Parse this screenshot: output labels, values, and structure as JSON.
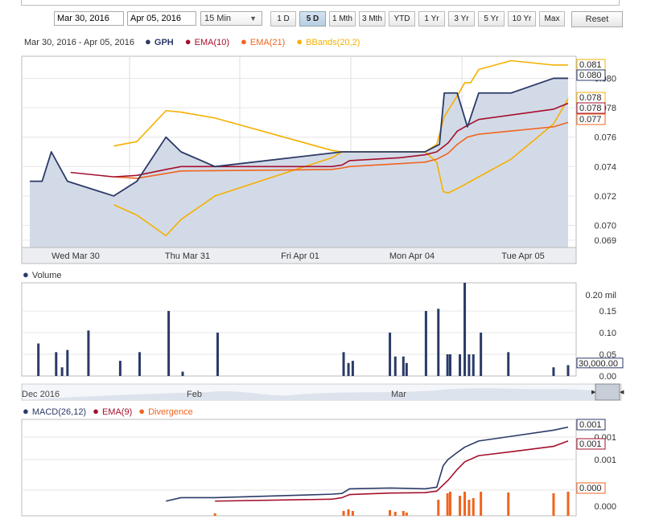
{
  "toolbar": {
    "start_date": "Mar 30, 2016",
    "end_date": "Apr 05, 2016",
    "interval": "15 Min",
    "ranges": [
      "1 D",
      "5 D",
      "1 Mth",
      "3 Mth",
      "YTD",
      "1 Yr",
      "3 Yr",
      "5 Yr",
      "10 Yr",
      "Max"
    ],
    "active_range": "5 D",
    "reset_label": "Reset"
  },
  "legend": {
    "date_range": "Mar 30, 2016 - Apr 05, 2016",
    "items": [
      {
        "label": "GPH",
        "color": "#2b3a67",
        "bold": true
      },
      {
        "label": "EMA(10)",
        "color": "#a50f2d",
        "bold": false
      },
      {
        "label": "EMA(21)",
        "color": "#f0641e",
        "bold": false
      },
      {
        "label": "BBands(20,2)",
        "color": "#f5b000",
        "bold": false
      }
    ]
  },
  "chart_data": [
    {
      "type": "area",
      "x_ticks": [
        "Wed Mar 30",
        "Thu Mar 31",
        "Fri Apr 01",
        "Mon Apr 04",
        "Tue Apr 05"
      ],
      "y_ticks": [
        0.069,
        0.07,
        0.072,
        0.074,
        0.076,
        0.078,
        0.08
      ],
      "ylim": [
        0.0685,
        0.0815
      ],
      "xlim": [
        0,
        100
      ],
      "grid": true,
      "last_value_labels": [
        {
          "text": "0.081",
          "value": 0.0812,
          "color": "#f5b000"
        },
        {
          "text": "0.080",
          "value": 0.08,
          "color": "#2b3a67"
        },
        {
          "text": "0.078",
          "value": 0.0786,
          "color": "#f5b000"
        },
        {
          "text": "0.078",
          "value": 0.078,
          "color": "#a50f2d"
        },
        {
          "text": "0.077",
          "value": 0.0772,
          "color": "#f0641e"
        }
      ],
      "series": [
        {
          "name": "GPH",
          "color": "#2b3a67",
          "fill": "#d3dae7",
          "x": [
            0,
            2.3,
            4,
            7,
            15.6,
            19.9,
            25.3,
            28.1,
            34.4,
            58,
            73.4,
            76.1,
            77,
            79.4,
            81.3,
            83.4,
            89.4,
            97.3,
            100
          ],
          "y": [
            0.073,
            0.073,
            0.075,
            0.073,
            0.072,
            0.073,
            0.076,
            0.075,
            0.074,
            0.075,
            0.075,
            0.0755,
            0.079,
            0.079,
            0.0767,
            0.079,
            0.079,
            0.08,
            0.08
          ]
        },
        {
          "name": "EMA(10)",
          "color": "#a50f2d",
          "x": [
            7.6,
            15.6,
            19.9,
            25.3,
            28.1,
            56.1,
            58,
            59.4,
            68.8,
            73.4,
            75.6,
            77.7,
            79.4,
            81.3,
            83.4,
            97.3,
            100
          ],
          "y": [
            0.0736,
            0.0733,
            0.0734,
            0.0738,
            0.074,
            0.074,
            0.0741,
            0.0744,
            0.0746,
            0.0748,
            0.075,
            0.0756,
            0.0764,
            0.0768,
            0.0772,
            0.0779,
            0.0783
          ]
        },
        {
          "name": "EMA(21)",
          "color": "#f0641e",
          "x": [
            15.6,
            19.9,
            28.1,
            56.1,
            58,
            59.4,
            68.8,
            73.4,
            75.6,
            77.7,
            79.4,
            81.3,
            83.4,
            97.3,
            100
          ],
          "y": [
            0.0733,
            0.0732,
            0.0737,
            0.0738,
            0.0739,
            0.074,
            0.0742,
            0.0743,
            0.0745,
            0.0749,
            0.0755,
            0.076,
            0.0762,
            0.0767,
            0.077
          ]
        },
        {
          "name": "BBands upper",
          "color": "#f5b000",
          "x": [
            15.6,
            19.9,
            25.3,
            28.1,
            34.4,
            56.1,
            58,
            73.4,
            75.6,
            77,
            79.4,
            80.8,
            81.9,
            83.4,
            89.4,
            97.3,
            100
          ],
          "y": [
            0.0754,
            0.0757,
            0.0778,
            0.0777,
            0.0773,
            0.0751,
            0.075,
            0.075,
            0.0755,
            0.0774,
            0.0788,
            0.0797,
            0.0797,
            0.0806,
            0.0812,
            0.0809,
            0.0809
          ]
        },
        {
          "name": "BBands lower",
          "color": "#f5b000",
          "x": [
            15.6,
            19.9,
            25.3,
            28.1,
            34.4,
            56.1,
            58,
            73.4,
            75.6,
            76.8,
            77.7,
            79.4,
            83.4,
            89.4,
            97.3,
            100
          ],
          "y": [
            0.0714,
            0.0707,
            0.0693,
            0.0704,
            0.072,
            0.0746,
            0.075,
            0.075,
            0.0743,
            0.0723,
            0.0722,
            0.0725,
            0.0733,
            0.0745,
            0.0769,
            0.0786
          ]
        }
      ]
    },
    {
      "type": "bar",
      "title": "Volume",
      "y_ticks": [
        0.0,
        0.05,
        0.1,
        0.15
      ],
      "y_tick_labels": [
        "0.00",
        "0.05",
        "0.10",
        "0.15"
      ],
      "top_label": "0.20 mil",
      "last_value_label": "30,000.00",
      "last_value": 0.03,
      "ylim": [
        0,
        0.215
      ],
      "xlim": [
        0,
        100
      ],
      "series": [
        {
          "name": "Volume",
          "color": "#2b3a67",
          "x": [
            1.6,
            4.9,
            6,
            7,
            10.9,
            16.8,
            20.4,
            25.8,
            28.4,
            34.9,
            58.3,
            59.2,
            60,
            66.9,
            67.9,
            69.4,
            70,
            73.6,
            75.9,
            77.6,
            78.1,
            79.9,
            80.8,
            81.6,
            82.4,
            83.8,
            88.9,
            97.3,
            100
          ],
          "y": [
            0.075,
            0.055,
            0.02,
            0.06,
            0.105,
            0.035,
            0.055,
            0.15,
            0.01,
            0.1,
            0.055,
            0.03,
            0.035,
            0.1,
            0.045,
            0.045,
            0.03,
            0.15,
            0.155,
            0.05,
            0.05,
            0.05,
            0.215,
            0.05,
            0.05,
            0.1,
            0.055,
            0.02,
            0.025
          ]
        }
      ]
    },
    {
      "type": "area",
      "title": "navigator",
      "x_ticks": [
        "Dec 2016",
        "Feb",
        "Mar"
      ],
      "series": []
    },
    {
      "type": "line",
      "y_tick_labels": [
        "0.001",
        "0.001",
        "0.000"
      ],
      "ylim": [
        -0.0011,
        0.0014
      ],
      "xlim": [
        0,
        100
      ],
      "last_value_labels": [
        {
          "text": "0.001",
          "value": 0.00122,
          "color": "#2b3a67"
        },
        {
          "text": "0.001",
          "value": 0.00082,
          "color": "#a50f2d"
        },
        {
          "text": "0.000",
          "value": -0.00032,
          "color": "#f0641e"
        }
      ],
      "series": [
        {
          "name": "MACD(26,12)",
          "color": "#2b3a67",
          "x": [
            25.3,
            28.1,
            34.4,
            56.1,
            58,
            59.4,
            66.9,
            73.4,
            75.6,
            76.8,
            77.7,
            79.4,
            80.8,
            83.4,
            89.4,
            97.3,
            100
          ],
          "y": [
            -0.00072,
            -0.00063,
            -0.00063,
            -0.00054,
            -0.00052,
            -0.0004,
            -0.00038,
            -0.0004,
            -0.00036,
            0.0002,
            0.00036,
            0.00054,
            0.00068,
            0.00084,
            0.00096,
            0.00112,
            0.0012
          ]
        },
        {
          "name": "EMA(9)",
          "color": "#a50f2d",
          "x": [
            34.4,
            56.1,
            58,
            59.4,
            66.9,
            73.4,
            75.6,
            77.7,
            79.4,
            80.8,
            83.4,
            89.4,
            97.3,
            100
          ],
          "y": [
            -0.00072,
            -0.00067,
            -0.00063,
            -0.00055,
            -0.00051,
            -0.0005,
            -0.00046,
            -0.00018,
            0.0001,
            0.0003,
            0.00046,
            0.00056,
            0.0007,
            0.00084
          ]
        },
        {
          "name": "Divergence",
          "color": "#f0641e",
          "type": "bar",
          "x": [
            34.4,
            58.3,
            59.2,
            60,
            66.9,
            67.9,
            69.4,
            70,
            75.9,
            77.6,
            78.1,
            79.9,
            80.8,
            81.6,
            82.4,
            83.8,
            88.9,
            97.3,
            100
          ],
          "y": [
            3e-05,
            6e-05,
            8e-05,
            6e-05,
            7e-05,
            5e-05,
            6e-05,
            4e-05,
            0.0002,
            0.00028,
            0.0003,
            0.00025,
            0.0003,
            0.0002,
            0.00022,
            0.0003,
            0.00029,
            0.00028,
            0.0003
          ]
        }
      ]
    }
  ],
  "volume_legend": {
    "label": "Volume",
    "color": "#2b3a67"
  },
  "macd_legend": {
    "items": [
      {
        "label": "MACD(26,12)",
        "color": "#2b3a67"
      },
      {
        "label": "EMA(9)",
        "color": "#a50f2d"
      },
      {
        "label": "Divergence",
        "color": "#f0641e"
      }
    ]
  }
}
